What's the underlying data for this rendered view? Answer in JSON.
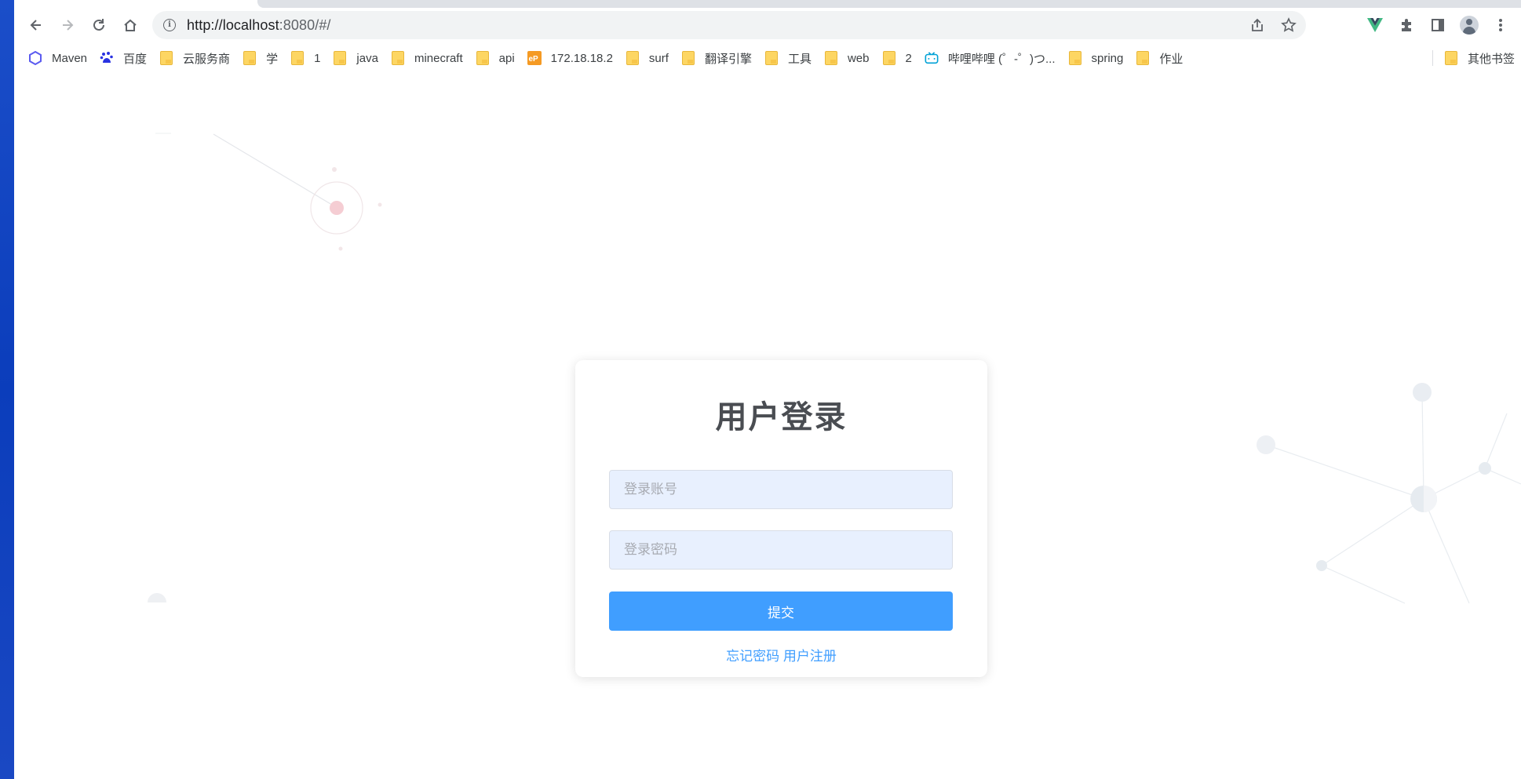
{
  "browser": {
    "url_host": "http://localhost",
    "url_rest": ":8080/#/",
    "nav_icons": {
      "back": "arrow-left-icon",
      "forward": "arrow-right-icon",
      "reload": "reload-icon",
      "home": "home-icon"
    },
    "toolbar_icons": [
      "share-icon",
      "star-icon"
    ],
    "extension_icons": [
      "vue-devtools-icon",
      "puzzle-icon",
      "side-panel-icon",
      "avatar-icon",
      "more-icon"
    ]
  },
  "bookmarks": {
    "items": [
      {
        "label": "Maven",
        "icon": "maven-icon"
      },
      {
        "label": "百度",
        "icon": "baidu-icon"
      },
      {
        "label": "云服务商",
        "icon": "folder-icon"
      },
      {
        "label": "学",
        "icon": "folder-icon"
      },
      {
        "label": "1",
        "icon": "folder-icon"
      },
      {
        "label": "java",
        "icon": "folder-icon"
      },
      {
        "label": "minecraft",
        "icon": "folder-icon"
      },
      {
        "label": "api",
        "icon": "folder-icon"
      },
      {
        "label": "172.18.18.2",
        "icon": "ep-icon"
      },
      {
        "label": "surf",
        "icon": "folder-icon"
      },
      {
        "label": "翻译引擎",
        "icon": "folder-icon"
      },
      {
        "label": "工具",
        "icon": "folder-icon"
      },
      {
        "label": "web",
        "icon": "folder-icon"
      },
      {
        "label": "2",
        "icon": "folder-icon"
      },
      {
        "label": "哔哩哔哩 (゜-゜)つ...",
        "icon": "bilibili-icon"
      },
      {
        "label": "spring",
        "icon": "folder-icon"
      },
      {
        "label": "作业",
        "icon": "folder-icon"
      }
    ],
    "other": {
      "label": "其他书签",
      "icon": "folder-icon"
    }
  },
  "login": {
    "title": "用户登录",
    "account_placeholder": "登录账号",
    "password_placeholder": "登录密码",
    "submit_label": "提交",
    "forgot_label": "忘记密码",
    "register_label": "用户注册"
  },
  "colors": {
    "primary": "#409eff",
    "input_bg": "#e8f0fe",
    "title": "#4a4d52"
  }
}
